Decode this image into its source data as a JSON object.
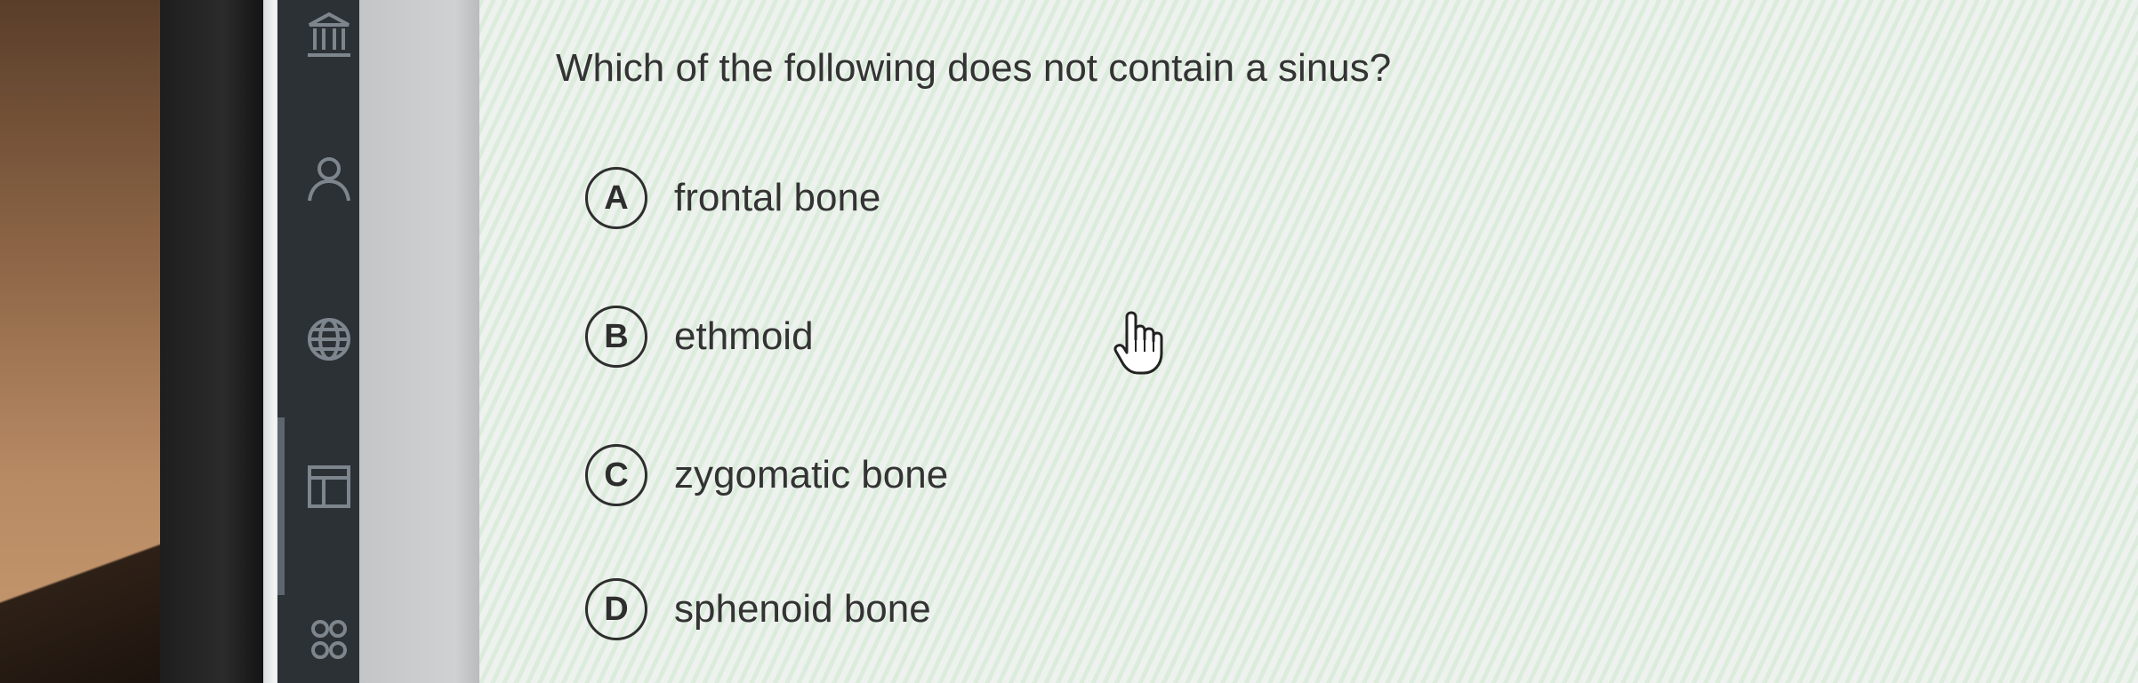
{
  "sidebar": {
    "icons": [
      {
        "name": "institution-icon"
      },
      {
        "name": "user-icon"
      },
      {
        "name": "globe-icon"
      },
      {
        "name": "layout-icon"
      },
      {
        "name": "group-icon"
      }
    ]
  },
  "quiz": {
    "question": "Which of the following does not contain a sinus?",
    "options": [
      {
        "letter": "A",
        "text": "frontal bone"
      },
      {
        "letter": "B",
        "text": "ethmoid"
      },
      {
        "letter": "C",
        "text": "zygomatic bone"
      },
      {
        "letter": "D",
        "text": "sphenoid bone"
      }
    ]
  },
  "colors": {
    "sidebar_bg": "#2c3136",
    "sidebar_icon": "#7e868d",
    "text": "#333333",
    "badge_border": "#2e2e2e"
  },
  "cursor": {
    "type": "hand-pointer"
  }
}
